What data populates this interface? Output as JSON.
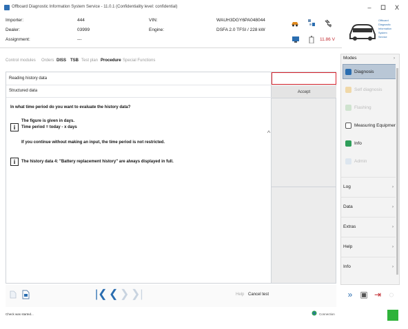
{
  "window": {
    "title": "Offboard Diagnostic Information System Service - 11.0.1 (Confidentiality level: confidential)",
    "minimize": "–",
    "maximize": "ロ",
    "close": "X"
  },
  "vehicle_info": {
    "importer_label": "Importer:",
    "importer_value": "444",
    "dealer_label": "Dealer:",
    "dealer_value": "03999",
    "assignment_label": "Assignment:",
    "assignment_value": "---",
    "vin_label": "VIN:",
    "vin_value": "WAUH3DGY6PA048044",
    "engine_label": "Engine:",
    "engine_value": "DSFA 2.0 TFSI / 228 kW",
    "voltage": "11.86 V"
  },
  "logo": {
    "lines": [
      "Offboard",
      "Diagnostic",
      "Information",
      "System",
      "Service"
    ]
  },
  "tabs": [
    {
      "label": "Control modules",
      "active": false
    },
    {
      "label": "Orders",
      "active": false
    },
    {
      "label": "DISS",
      "active": false
    },
    {
      "label": "TSB",
      "active": false
    },
    {
      "label": "Test plan",
      "active": false
    },
    {
      "label": "Procedure",
      "active": true
    },
    {
      "label": "Special Functions",
      "active": false
    }
  ],
  "procedure": {
    "row1": "Reading history data",
    "row2": "Structured data",
    "question": "In what time period do you want to evaluate the history data?",
    "note1_line1": "The figure is given in days.",
    "note1_line2": "Time period = today - x days",
    "note1_line3": "If you continue without making an input, the time period is not restricted.",
    "note2": "The history data 4: \"Battery replacement history\" are always displayed in full.",
    "input_value": "",
    "accept_label": "Accept"
  },
  "bottom": {
    "help_label": "Help",
    "cancel_label": "Cancel test"
  },
  "modes": {
    "header": "Modes",
    "items": [
      {
        "label": "Diagnosis",
        "state": "selected"
      },
      {
        "label": "Self diagnosis",
        "state": "disabled"
      },
      {
        "label": "Flashing",
        "state": "disabled"
      },
      {
        "label": "Measuring Equipment",
        "state": "normal"
      },
      {
        "label": "Info",
        "state": "normal"
      },
      {
        "label": "Admin",
        "state": "disabled"
      }
    ],
    "sections": [
      "Log",
      "Data",
      "Extras",
      "Help",
      "Info"
    ]
  },
  "status": {
    "text": "Check was started...",
    "connection": "Connection"
  },
  "colors": {
    "accent": "#2a6db0",
    "error_border": "#d9232d",
    "selected_mode": "#b9c7d6",
    "status_ok": "#2fb33a"
  }
}
